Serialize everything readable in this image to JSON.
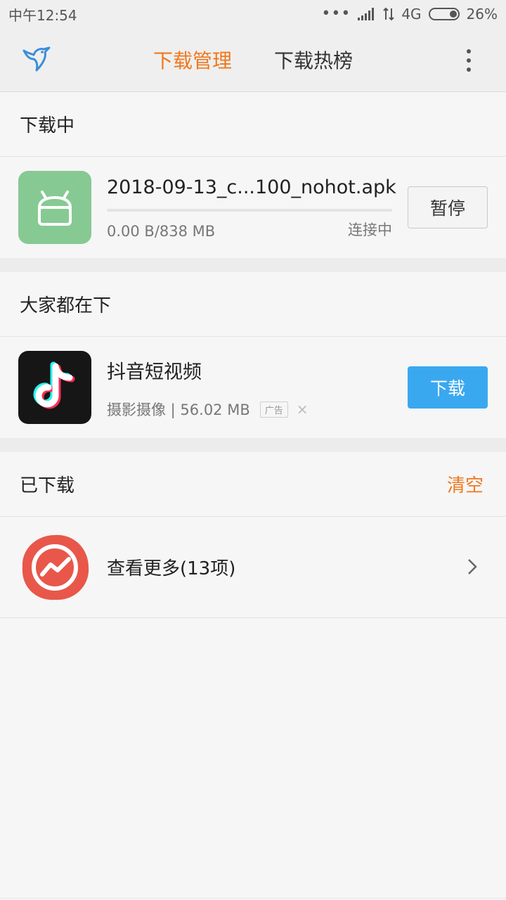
{
  "statusbar": {
    "time": "中午12:54",
    "network": "4G",
    "battery": "26%",
    "battery_level": 0.26,
    "icons": [
      "more-dots-icon",
      "signal-icon",
      "data-arrows-icon",
      "battery-icon"
    ]
  },
  "appbar": {
    "logo_icon": "bird-logo-icon",
    "tabs": [
      {
        "label": "下载管理",
        "active": true
      },
      {
        "label": "下载热榜",
        "active": false
      }
    ],
    "menu_icon": "more-vertical-icon"
  },
  "downloading": {
    "header": "下载中",
    "item": {
      "icon": "android-app-icon",
      "filename": "2018-09-13_c...100_nohot.apk",
      "size_text": "0.00 B/838 MB",
      "progress": 0,
      "status": "连接中",
      "button": "暂停"
    }
  },
  "popular": {
    "header": "大家都在下",
    "item": {
      "icon": "tiktok-app-icon",
      "name": "抖音短视频",
      "meta": "摄影摄像 | 56.02 MB",
      "ad_label": "广告",
      "close": "×",
      "button": "下载"
    }
  },
  "downloaded": {
    "header": "已下载",
    "action": "清空",
    "more_label": "查看更多(13项)",
    "icon": "stock-chart-icon"
  },
  "colors": {
    "accent": "#f0781e",
    "primary_button": "#3aa8ef",
    "android_green": "#87c993"
  }
}
